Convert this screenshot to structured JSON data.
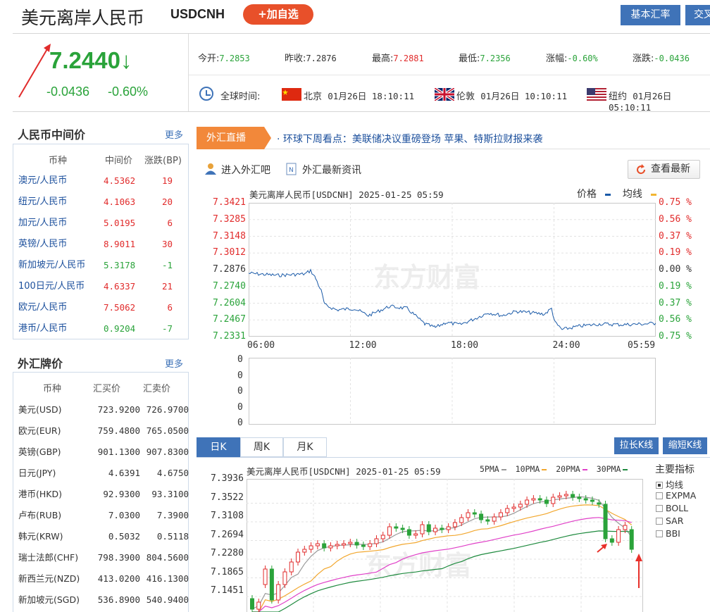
{
  "header": {
    "title": "美元离岸人民币",
    "code": "USDCNH",
    "add_button": "+加自选",
    "tabs": [
      "基本汇率",
      "交叉汇率"
    ]
  },
  "quote": {
    "price": "7.2440",
    "arrow": "↓",
    "change": "-0.0436",
    "change_pct": "-0.60%",
    "stats": [
      {
        "label": "今开:",
        "value": "7.2853",
        "color": "green"
      },
      {
        "label": "昨收:",
        "value": "7.2876",
        "color": "normal"
      },
      {
        "label": "最高:",
        "value": "7.2881",
        "color": "red"
      },
      {
        "label": "最低:",
        "value": "7.2356",
        "color": "green"
      },
      {
        "label": "涨幅:",
        "value": "-0.60%",
        "color": "green"
      },
      {
        "label": "涨跌:",
        "value": "-0.0436",
        "color": "green"
      }
    ],
    "global_time_label": "全球时间:",
    "times": [
      {
        "city": "北京",
        "time": "01月26日  18:10:11",
        "flag": "cn-flag-icon"
      },
      {
        "city": "伦敦",
        "time": "01月26日  10:10:11",
        "flag": "uk-flag-icon"
      },
      {
        "city": "纽约",
        "time": "01月26日  05:10:11",
        "flag": "us-flag-icon"
      }
    ]
  },
  "rmb_mid": {
    "title": "人民币中间价",
    "more": "更多",
    "headers": [
      "币种",
      "中间价",
      "涨跌(BP)"
    ],
    "rows": [
      {
        "name": "澳元/人民币",
        "price": "4.5362",
        "bp": "19",
        "color": "red"
      },
      {
        "name": "纽元/人民币",
        "price": "4.1063",
        "bp": "20",
        "color": "red"
      },
      {
        "name": "加元/人民币",
        "price": "5.0195",
        "bp": "6",
        "color": "red"
      },
      {
        "name": "英镑/人民币",
        "price": "8.9011",
        "bp": "30",
        "color": "red"
      },
      {
        "name": "新加坡元/人民币",
        "price": "5.3178",
        "bp": "-1",
        "color": "green"
      },
      {
        "name": "100日元/人民币",
        "price": "4.6337",
        "bp": "21",
        "color": "red"
      },
      {
        "name": "欧元/人民币",
        "price": "7.5062",
        "bp": "6",
        "color": "red"
      },
      {
        "name": "港币/人民币",
        "price": "0.9204",
        "bp": "-7",
        "color": "green"
      }
    ]
  },
  "fx_board": {
    "title": "外汇牌价",
    "more": "更多",
    "headers": [
      "币种",
      "汇买价",
      "汇卖价"
    ],
    "rows": [
      {
        "name": "美元(USD)",
        "buy": "723.9200",
        "sell": "726.9700"
      },
      {
        "name": "欧元(EUR)",
        "buy": "759.4800",
        "sell": "765.0500"
      },
      {
        "name": "英镑(GBP)",
        "buy": "901.1300",
        "sell": "907.8300"
      },
      {
        "name": "日元(JPY)",
        "buy": "4.6391",
        "sell": "4.6750"
      },
      {
        "name": "港币(HKD)",
        "buy": "92.9300",
        "sell": "93.3100"
      },
      {
        "name": "卢布(RUB)",
        "buy": "7.0300",
        "sell": "7.3900"
      },
      {
        "name": "韩元(KRW)",
        "buy": "0.5032",
        "sell": "0.5118"
      },
      {
        "name": "瑞士法郎(CHF)",
        "buy": "798.3900",
        "sell": "804.5600"
      },
      {
        "name": "新西兰元(NZD)",
        "buy": "413.0200",
        "sell": "416.1300"
      },
      {
        "name": "新加坡元(SGD)",
        "buy": "536.8900",
        "sell": "540.9400"
      }
    ]
  },
  "live": {
    "tag": "外汇直播",
    "headline": "· 环球下周看点：美联储决议重磅登场 苹果、特斯拉财报来袭"
  },
  "tools": {
    "forum": "进入外汇吧",
    "news": "外汇最新资讯",
    "refresh": "查看最新"
  },
  "intraday": {
    "title": "美元离岸人民币[USDCNH] 2025-01-25 05:59",
    "legend_price": "价格",
    "legend_avg": "均线",
    "watermark": "东方财富",
    "y_prices": [
      "7.3421",
      "7.3285",
      "7.3148",
      "7.3012",
      "7.2876",
      "7.2740",
      "7.2604",
      "7.2467",
      "7.2331"
    ],
    "y_pcts": [
      "0.75 %",
      "0.56 %",
      "0.37 %",
      "0.19 %",
      "0.00 %",
      "0.19 %",
      "0.37 %",
      "0.56 %",
      "0.75 %"
    ],
    "x_labels": [
      "06:00",
      "12:00",
      "18:00",
      "24:00",
      "05:59"
    ],
    "volume_labels": [
      "0",
      "0",
      "0",
      "0",
      "0"
    ]
  },
  "kline": {
    "tabs": [
      "日K",
      "周K",
      "月K"
    ],
    "buttons": [
      "拉长K线",
      "缩短K线"
    ],
    "title": "美元离岸人民币[USDCNH] 2025-01-25 05:59",
    "ma_legend": [
      "5PMA",
      "10PMA",
      "20PMA",
      "30PMA"
    ],
    "y_labels": [
      "7.3936",
      "7.3522",
      "7.3108",
      "7.2694",
      "7.2280",
      "7.1865",
      "7.1451"
    ],
    "watermark": "东方财富",
    "indicator_title": "主要指标",
    "indicators": [
      {
        "name": "均线",
        "checked": true
      },
      {
        "name": "EXPMA",
        "checked": false
      },
      {
        "name": "BOLL",
        "checked": false
      },
      {
        "name": "SAR",
        "checked": false
      },
      {
        "name": "BBI",
        "checked": false
      }
    ]
  },
  "colors": {
    "up": "#e12b2b",
    "down": "#2aa33a",
    "accent": "#3f73b8",
    "orange": "#f2883a"
  }
}
